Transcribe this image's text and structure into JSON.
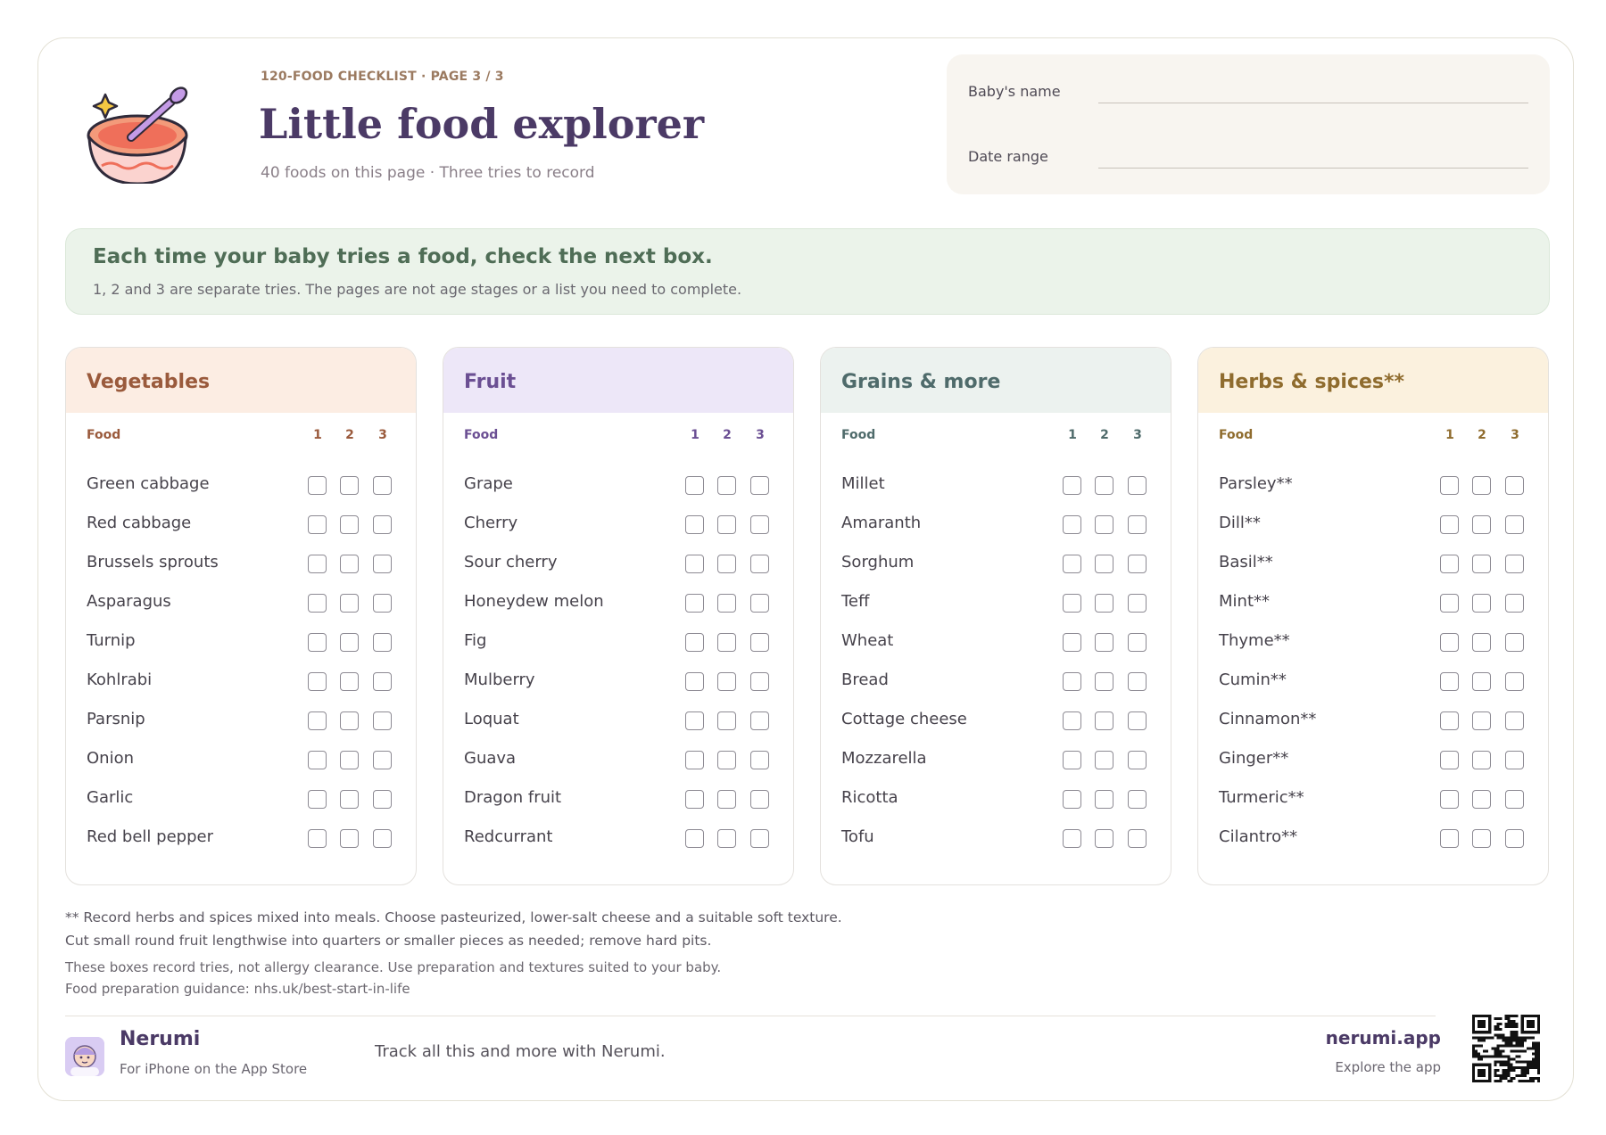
{
  "header": {
    "kicker": "120-FOOD CHECKLIST · PAGE 3 / 3",
    "title": "Little food explorer",
    "subtitle": "40 foods on this page · Three tries to record",
    "logo_icon": "bowl-with-spoon-icon"
  },
  "form": {
    "name_label": "Baby's name",
    "date_label": "Date range"
  },
  "banner": {
    "title": "Each time your baby tries a food, check the next box.",
    "subtitle": "1, 2 and 3 are separate tries. The pages are not age stages or a list you need to complete."
  },
  "table_headers": {
    "food": "Food",
    "try1": "1",
    "try2": "2",
    "try3": "3"
  },
  "categories": [
    {
      "title": "Vegetables",
      "head_bg": "#fcede3",
      "accent": "#9a5a3c",
      "foods": [
        "Green cabbage",
        "Red cabbage",
        "Brussels sprouts",
        "Asparagus",
        "Turnip",
        "Kohlrabi",
        "Parsnip",
        "Onion",
        "Garlic",
        "Red bell pepper"
      ]
    },
    {
      "title": "Fruit",
      "head_bg": "#ede7f8",
      "accent": "#6b4f93",
      "foods": [
        "Grape",
        "Cherry",
        "Sour cherry",
        "Honeydew melon",
        "Fig",
        "Mulberry",
        "Loquat",
        "Guava",
        "Dragon fruit",
        "Redcurrant"
      ]
    },
    {
      "title": "Grains & more",
      "head_bg": "#ecf2ef",
      "accent": "#4f6b6b",
      "foods": [
        "Millet",
        "Amaranth",
        "Sorghum",
        "Teff",
        "Wheat",
        "Bread",
        "Cottage cheese",
        "Mozzarella",
        "Ricotta",
        "Tofu"
      ]
    },
    {
      "title": "Herbs & spices**",
      "head_bg": "#fbf1de",
      "accent": "#8f6c2e",
      "foods": [
        "Parsley**",
        "Dill**",
        "Basil**",
        "Mint**",
        "Thyme**",
        "Cumin**",
        "Cinnamon**",
        "Ginger**",
        "Turmeric**",
        "Cilantro**"
      ]
    }
  ],
  "notes": {
    "line1": "** Record herbs and spices mixed into meals. Choose pasteurized, lower-salt cheese and a suitable soft texture.",
    "line2": "Cut small round fruit lengthwise into quarters or smaller pieces as needed; remove hard pits.",
    "line3": "These boxes record tries, not allergy clearance. Use preparation and textures suited to your baby.",
    "line4": "Food preparation guidance: nhs.uk/best-start-in-life"
  },
  "footer": {
    "brand": "Nerumi",
    "brand_sub": "For iPhone on the App Store",
    "tagline": "Track all this and more with Nerumi.",
    "site": "nerumi.app",
    "site_sub": "Explore the app",
    "app_icon": "baby-app-icon",
    "qr_icon": "qr-code-icon"
  }
}
